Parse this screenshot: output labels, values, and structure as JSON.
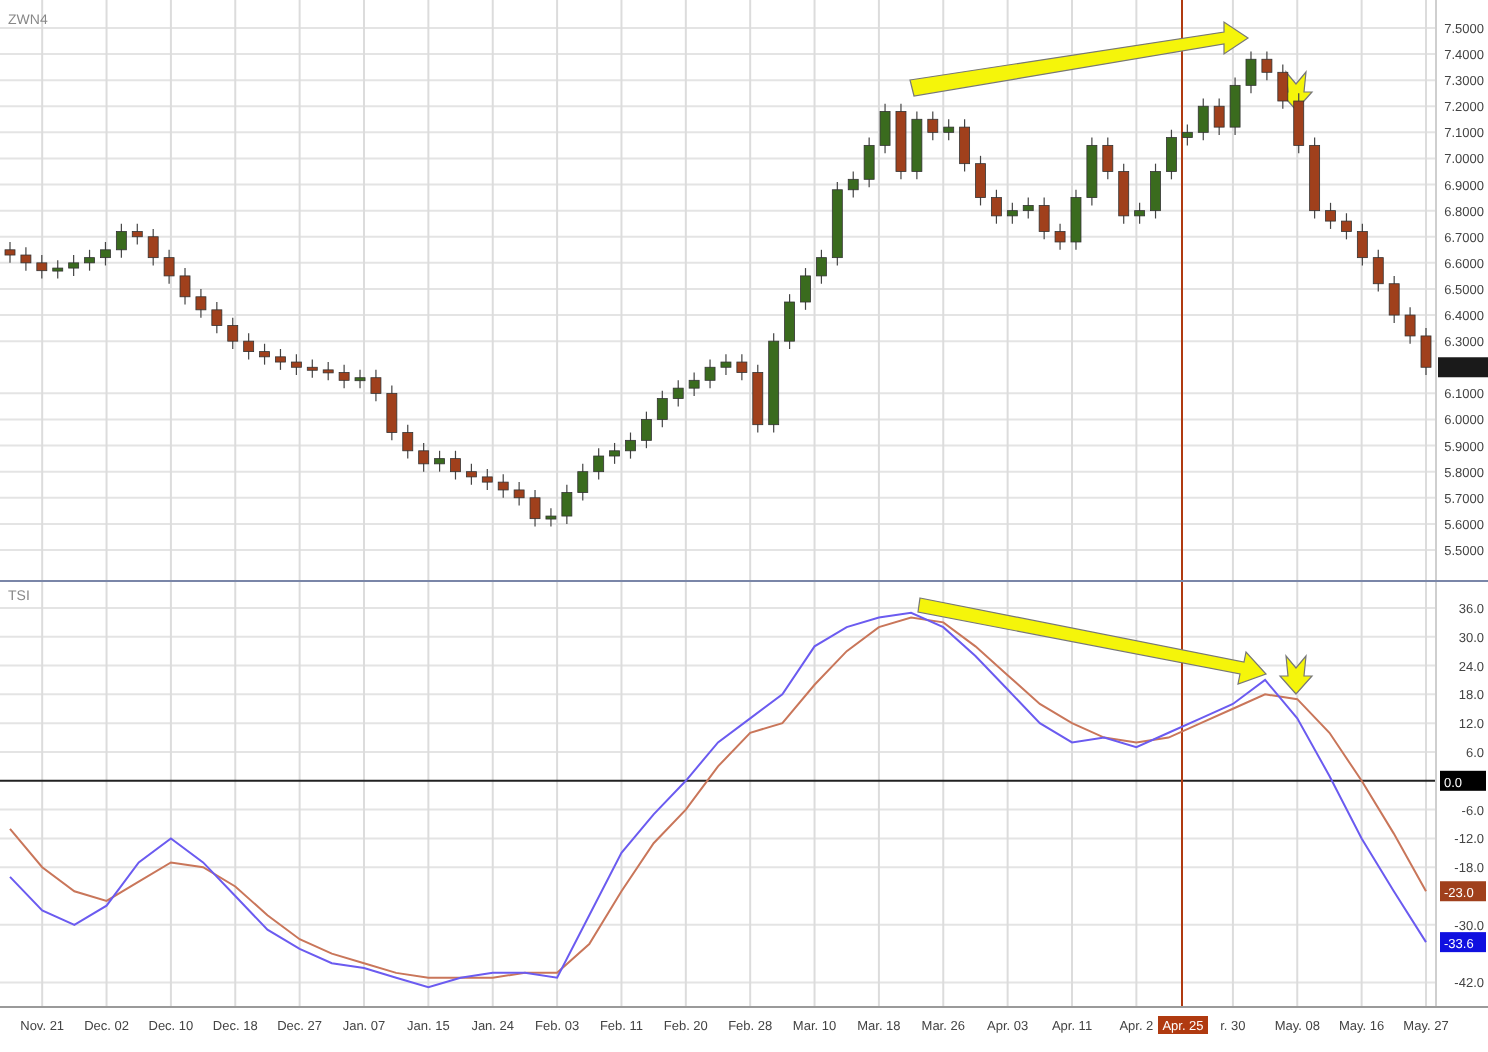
{
  "price_panel": {
    "chart_data": {
      "type": "candlestick",
      "title": "ZWN4",
      "grid": true,
      "ylim": [
        5.385,
        7.607
      ],
      "categories": [
        null,
        null,
        null,
        null,
        null,
        null,
        null,
        null,
        null,
        null,
        null,
        null,
        null,
        null,
        null,
        null,
        null,
        null,
        null,
        null,
        null,
        null,
        null,
        null,
        null,
        null,
        null,
        null,
        null,
        null,
        null,
        null,
        null,
        null,
        null,
        null,
        null,
        null,
        null,
        null,
        null,
        null,
        null,
        null,
        null,
        null,
        null,
        null,
        null,
        null,
        null,
        null,
        null,
        null,
        null,
        null,
        null,
        null,
        null,
        null,
        null,
        null,
        null,
        null,
        null,
        null,
        null,
        null,
        null,
        null,
        null,
        null,
        null,
        null,
        null,
        null,
        null,
        null,
        null,
        null,
        null,
        null,
        null,
        null,
        null,
        null,
        null,
        null,
        null,
        null
      ],
      "ohlc": [
        [
          6.65,
          6.68,
          6.6,
          6.63
        ],
        [
          6.63,
          6.66,
          6.57,
          6.6
        ],
        [
          6.6,
          6.63,
          6.54,
          6.57
        ],
        [
          6.57,
          6.61,
          6.54,
          6.58
        ],
        [
          6.58,
          6.63,
          6.55,
          6.6
        ],
        [
          6.6,
          6.65,
          6.57,
          6.62
        ],
        [
          6.62,
          6.68,
          6.59,
          6.65
        ],
        [
          6.65,
          6.75,
          6.62,
          6.72
        ],
        [
          6.72,
          6.75,
          6.67,
          6.7
        ],
        [
          6.7,
          6.73,
          6.59,
          6.62
        ],
        [
          6.62,
          6.65,
          6.52,
          6.55
        ],
        [
          6.55,
          6.58,
          6.44,
          6.47
        ],
        [
          6.47,
          6.5,
          6.39,
          6.42
        ],
        [
          6.42,
          6.45,
          6.33,
          6.36
        ],
        [
          6.36,
          6.39,
          6.27,
          6.3
        ],
        [
          6.3,
          6.33,
          6.23,
          6.26
        ],
        [
          6.26,
          6.29,
          6.21,
          6.24
        ],
        [
          6.24,
          6.27,
          6.19,
          6.22
        ],
        [
          6.22,
          6.25,
          6.17,
          6.2
        ],
        [
          6.2,
          6.23,
          6.16,
          6.19
        ],
        [
          6.19,
          6.22,
          6.15,
          6.18
        ],
        [
          6.18,
          6.21,
          6.12,
          6.15
        ],
        [
          6.15,
          6.19,
          6.12,
          6.16
        ],
        [
          6.16,
          6.19,
          6.07,
          6.1
        ],
        [
          6.1,
          6.13,
          5.92,
          5.95
        ],
        [
          5.95,
          5.98,
          5.85,
          5.88
        ],
        [
          5.88,
          5.91,
          5.8,
          5.83
        ],
        [
          5.83,
          5.88,
          5.8,
          5.85
        ],
        [
          5.85,
          5.88,
          5.77,
          5.8
        ],
        [
          5.8,
          5.83,
          5.75,
          5.78
        ],
        [
          5.78,
          5.81,
          5.73,
          5.76
        ],
        [
          5.76,
          5.79,
          5.7,
          5.73
        ],
        [
          5.73,
          5.76,
          5.67,
          5.7
        ],
        [
          5.7,
          5.73,
          5.59,
          5.62
        ],
        [
          5.62,
          5.66,
          5.59,
          5.63
        ],
        [
          5.63,
          5.75,
          5.6,
          5.72
        ],
        [
          5.72,
          5.83,
          5.69,
          5.8
        ],
        [
          5.8,
          5.89,
          5.77,
          5.86
        ],
        [
          5.86,
          5.91,
          5.83,
          5.88
        ],
        [
          5.88,
          5.95,
          5.85,
          5.92
        ],
        [
          5.92,
          6.03,
          5.89,
          6.0
        ],
        [
          6.0,
          6.11,
          5.97,
          6.08
        ],
        [
          6.08,
          6.15,
          6.05,
          6.12
        ],
        [
          6.12,
          6.18,
          6.09,
          6.15
        ],
        [
          6.15,
          6.23,
          6.12,
          6.2
        ],
        [
          6.2,
          6.25,
          6.17,
          6.22
        ],
        [
          6.22,
          6.25,
          6.15,
          6.18
        ],
        [
          6.18,
          6.21,
          5.95,
          5.98
        ],
        [
          5.98,
          6.33,
          5.95,
          6.3
        ],
        [
          6.3,
          6.48,
          6.27,
          6.45
        ],
        [
          6.45,
          6.58,
          6.42,
          6.55
        ],
        [
          6.55,
          6.65,
          6.52,
          6.62
        ],
        [
          6.62,
          6.91,
          6.59,
          6.88
        ],
        [
          6.88,
          6.95,
          6.85,
          6.92
        ],
        [
          6.92,
          7.08,
          6.89,
          7.05
        ],
        [
          7.05,
          7.21,
          7.02,
          7.18
        ],
        [
          7.18,
          7.21,
          6.92,
          6.95
        ],
        [
          6.95,
          7.18,
          6.92,
          7.15
        ],
        [
          7.15,
          7.18,
          7.07,
          7.1
        ],
        [
          7.1,
          7.15,
          7.07,
          7.12
        ],
        [
          7.12,
          7.15,
          6.95,
          6.98
        ],
        [
          6.98,
          7.01,
          6.82,
          6.85
        ],
        [
          6.85,
          6.88,
          6.75,
          6.78
        ],
        [
          6.78,
          6.83,
          6.75,
          6.8
        ],
        [
          6.8,
          6.85,
          6.77,
          6.82
        ],
        [
          6.82,
          6.85,
          6.69,
          6.72
        ],
        [
          6.72,
          6.75,
          6.65,
          6.68
        ],
        [
          6.68,
          6.88,
          6.65,
          6.85
        ],
        [
          6.85,
          7.08,
          6.82,
          7.05
        ],
        [
          7.05,
          7.08,
          6.92,
          6.95
        ],
        [
          6.95,
          6.98,
          6.75,
          6.78
        ],
        [
          6.78,
          6.83,
          6.75,
          6.8
        ],
        [
          6.8,
          6.98,
          6.77,
          6.95
        ],
        [
          6.95,
          7.11,
          6.92,
          7.08
        ],
        [
          7.08,
          7.13,
          7.05,
          7.1
        ],
        [
          7.1,
          7.23,
          7.07,
          7.2
        ],
        [
          7.2,
          7.23,
          7.09,
          7.12
        ],
        [
          7.12,
          7.31,
          7.09,
          7.28
        ],
        [
          7.28,
          7.41,
          7.25,
          7.38
        ],
        [
          7.38,
          7.41,
          7.3,
          7.33
        ],
        [
          7.33,
          7.36,
          7.19,
          7.22
        ],
        [
          7.22,
          7.25,
          7.02,
          7.05
        ],
        [
          7.05,
          7.08,
          6.77,
          6.8
        ],
        [
          6.8,
          6.83,
          6.73,
          6.76
        ],
        [
          6.76,
          6.79,
          6.69,
          6.72
        ],
        [
          6.72,
          6.75,
          6.59,
          6.62
        ],
        [
          6.62,
          6.65,
          6.49,
          6.52
        ],
        [
          6.52,
          6.55,
          6.37,
          6.4
        ],
        [
          6.4,
          6.43,
          6.29,
          6.32
        ],
        [
          6.32,
          6.35,
          6.17,
          6.2
        ]
      ],
      "yticks": [
        {
          "value": 7.5,
          "label": "7.5000"
        },
        {
          "value": 7.4,
          "label": "7.4000"
        },
        {
          "value": 7.3,
          "label": "7.3000"
        },
        {
          "value": 7.2,
          "label": "7.2000"
        },
        {
          "value": 7.1,
          "label": "7.1000"
        },
        {
          "value": 7.0,
          "label": "7.0000"
        },
        {
          "value": 6.9,
          "label": "6.9000"
        },
        {
          "value": 6.8,
          "label": "6.8000"
        },
        {
          "value": 6.7,
          "label": "6.7000"
        },
        {
          "value": 6.6,
          "label": "6.6000"
        },
        {
          "value": 6.5,
          "label": "6.5000"
        },
        {
          "value": 6.4,
          "label": "6.4000"
        },
        {
          "value": 6.3,
          "label": "6.3000"
        },
        {
          "value": 6.1,
          "label": "6.1000"
        },
        {
          "value": 6.0,
          "label": "6.0000"
        },
        {
          "value": 5.9,
          "label": "5.9000"
        },
        {
          "value": 5.8,
          "label": "5.8000"
        },
        {
          "value": 5.7,
          "label": "5.7000"
        },
        {
          "value": 5.6,
          "label": "5.6000"
        },
        {
          "value": 5.5,
          "label": "5.5000"
        }
      ]
    }
  },
  "tsi_panel": {
    "chart_data": {
      "type": "line",
      "title": "TSI",
      "grid": true,
      "ylim": [
        -46.9,
        41.4
      ],
      "categories": [
        null,
        "Nov. 21",
        null,
        "Dec. 02",
        null,
        "Dec. 10",
        null,
        "Dec. 18",
        null,
        "Dec. 27",
        null,
        "Jan. 07",
        null,
        "Jan. 15",
        null,
        "Jan. 24",
        null,
        "Feb. 03",
        null,
        "Feb. 11",
        null,
        "Feb. 20",
        null,
        "Feb. 28",
        null,
        "Mar. 10",
        null,
        "Mar. 18",
        null,
        "Mar. 26",
        null,
        "Apr. 03",
        null,
        "Apr. 11",
        null,
        "Apr. 2",
        null,
        null,
        "r. 30",
        null,
        "May. 08",
        null,
        "May. 16",
        null,
        "May. 27"
      ],
      "series": [
        {
          "color": "#c9765a",
          "values": [
            -10,
            -18,
            -23,
            -25,
            -21,
            -17,
            -18,
            -22,
            -28,
            -33,
            -36,
            -38,
            -40,
            -41,
            -41,
            -41,
            -40,
            -40,
            -34,
            -23,
            -13,
            -6,
            3,
            10,
            12,
            20,
            27,
            32,
            34,
            33,
            28,
            22,
            16,
            12,
            9,
            8,
            9,
            12,
            15,
            18,
            17,
            10,
            0,
            -11,
            -23
          ]
        },
        {
          "color": "#6b5bf0",
          "values": [
            -20,
            -27,
            -30,
            -26,
            -17,
            -12,
            -17,
            -24,
            -31,
            -35,
            -38,
            -39,
            -41,
            -43,
            -41,
            -40,
            -40,
            -41,
            -28,
            -15,
            -7,
            0,
            8,
            13,
            18,
            28,
            32,
            34,
            35,
            32,
            26,
            19,
            12,
            8,
            9,
            7,
            10,
            13,
            16,
            21,
            13,
            1,
            -12,
            -23,
            -33.6
          ]
        }
      ],
      "yticks": [
        {
          "value": 36,
          "label": "36.0"
        },
        {
          "value": 30,
          "label": "30.0"
        },
        {
          "value": 24,
          "label": "24.0"
        },
        {
          "value": 18,
          "label": "18.0"
        },
        {
          "value": 12,
          "label": "12.0"
        },
        {
          "value": 6,
          "label": "6.0"
        },
        {
          "value": -6,
          "label": "-6.0"
        },
        {
          "value": -12,
          "label": "-12.0"
        },
        {
          "value": -18,
          "label": "-18.0"
        },
        {
          "value": -30,
          "label": "-30.0"
        },
        {
          "value": -42,
          "label": "-42.0"
        }
      ]
    },
    "zero_tag": {
      "label": "0.0",
      "color": "#000000"
    },
    "last_value_tags": [
      {
        "label": "-23.0",
        "color": "#a0401c"
      },
      {
        "label": "-33.6",
        "color": "#1010e0"
      }
    ],
    "cursor_date": {
      "label": "Apr. 25",
      "color": "#b03a10"
    }
  }
}
